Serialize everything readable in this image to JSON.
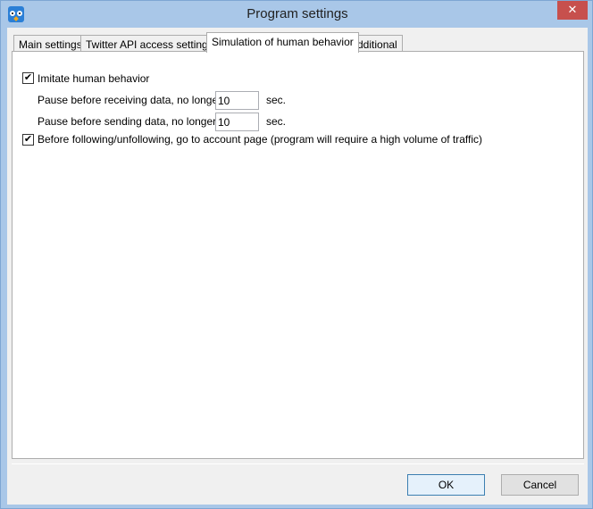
{
  "window": {
    "title": "Program settings",
    "close_glyph": "✕",
    "app_icon": "owl-icon"
  },
  "tabs": [
    {
      "label": "Main settings"
    },
    {
      "label": "Twitter API access settings"
    },
    {
      "label": "Simulation of human behavior"
    },
    {
      "label": "Additional"
    }
  ],
  "active_tab": "Simulation of human behavior",
  "panel": {
    "imitate": {
      "label": "Imitate human behavior",
      "checked": true
    },
    "pause_receiving": {
      "label": "Pause before receiving data, no longer th",
      "value": "10",
      "unit": "sec."
    },
    "pause_sending": {
      "label": "Pause before sending data, no longer tha",
      "value": "10",
      "unit": "sec."
    },
    "account_page": {
      "label": "Before following/unfollowing, go to account page (program will require a high volume of traffic)",
      "checked": true
    }
  },
  "buttons": {
    "ok": "OK",
    "cancel": "Cancel"
  },
  "colors": {
    "frame": "#a9c7e8",
    "close": "#c7504d",
    "client": "#f0f0f0"
  }
}
